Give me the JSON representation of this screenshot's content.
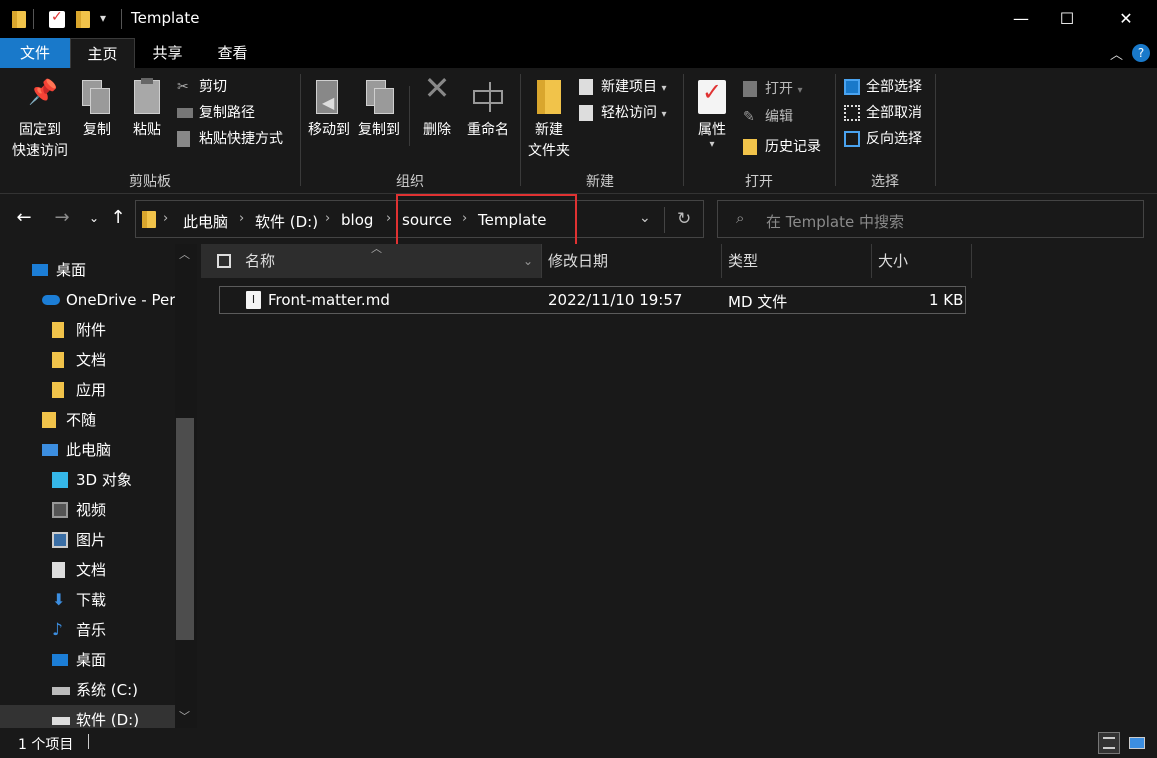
{
  "window": {
    "title": "Template",
    "minimize": "—",
    "maximize": "☐",
    "close": "✕"
  },
  "ribbon_tabs": {
    "file": "文件",
    "home": "主页",
    "share": "共享",
    "view": "查看"
  },
  "ribbon": {
    "clipboard": {
      "label": "剪贴板",
      "pin": "固定到\n快速访问",
      "copy": "复制",
      "paste": "粘贴",
      "cut": "剪切",
      "copy_path": "复制路径",
      "paste_shortcut": "粘贴快捷方式"
    },
    "organize": {
      "label": "组织",
      "move_to": "移动到",
      "copy_to": "复制到",
      "delete": "删除",
      "rename": "重命名"
    },
    "new": {
      "label": "新建",
      "new_folder": "新建\n文件夹",
      "new_item": "新建项目",
      "easy_access": "轻松访问"
    },
    "open": {
      "label": "打开",
      "properties": "属性",
      "open": "打开",
      "edit": "编辑",
      "history": "历史记录"
    },
    "select": {
      "label": "选择",
      "select_all": "全部选择",
      "select_none": "全部取消",
      "invert": "反向选择"
    }
  },
  "address": {
    "crumbs": [
      "此电脑",
      "软件 (D:)",
      "blog",
      "source",
      "Template"
    ],
    "search_placeholder": "在 Template 中搜索"
  },
  "nav": {
    "items": [
      {
        "label": "桌面",
        "icon": "desktop-icon"
      },
      {
        "label": "OneDrive - Pers",
        "icon": "onedrive-icon"
      },
      {
        "label": "附件",
        "icon": "folder-icon"
      },
      {
        "label": "文档",
        "icon": "folder-icon"
      },
      {
        "label": "应用",
        "icon": "folder-icon"
      },
      {
        "label": "不随",
        "icon": "user-folder-icon"
      },
      {
        "label": "此电脑",
        "icon": "computer-icon"
      },
      {
        "label": "3D 对象",
        "icon": "3d-objects-icon"
      },
      {
        "label": "视频",
        "icon": "video-icon"
      },
      {
        "label": "图片",
        "icon": "pictures-icon"
      },
      {
        "label": "文档",
        "icon": "documents-icon"
      },
      {
        "label": "下载",
        "icon": "download-icon"
      },
      {
        "label": "音乐",
        "icon": "music-icon"
      },
      {
        "label": "桌面",
        "icon": "desktop-icon"
      },
      {
        "label": "系统 (C:)",
        "icon": "drive-icon"
      },
      {
        "label": "软件 (D:)",
        "icon": "drive-icon"
      }
    ]
  },
  "columns": {
    "name": "名称",
    "date": "修改日期",
    "type": "类型",
    "size": "大小"
  },
  "files": [
    {
      "name": "Front-matter.md",
      "date": "2022/11/10 19:57",
      "type": "MD 文件",
      "size": "1 KB"
    }
  ],
  "status": {
    "count": "1 个项目"
  },
  "colors": {
    "accent": "#1979ca",
    "highlight": "#e03232",
    "folder": "#f1c34a"
  }
}
